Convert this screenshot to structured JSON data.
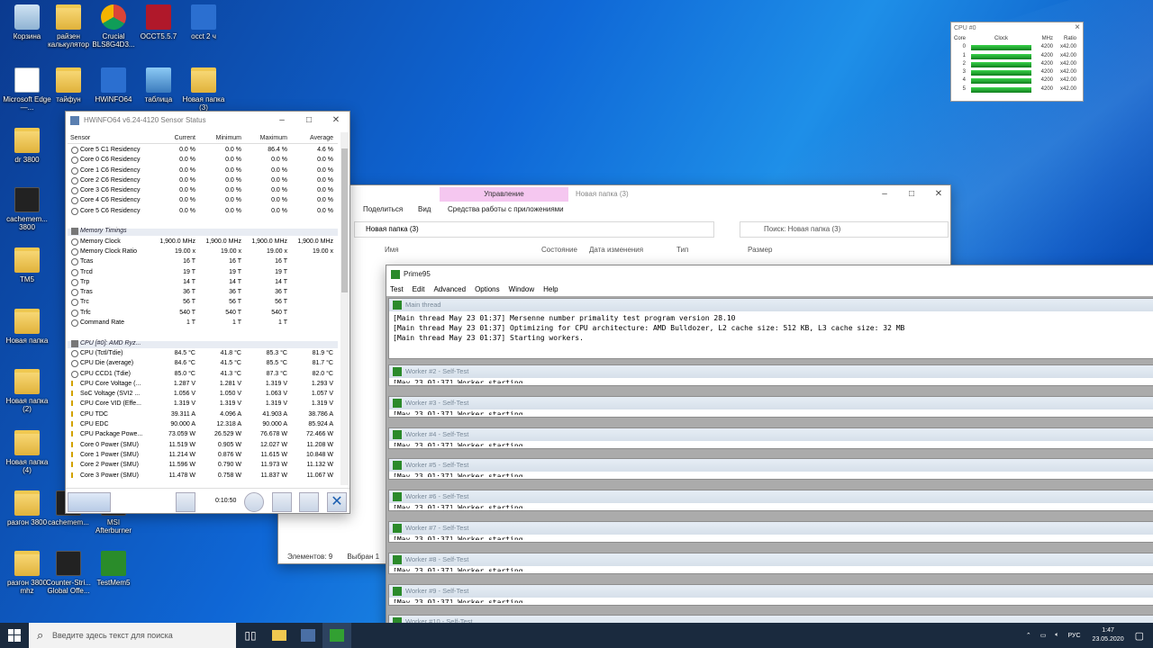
{
  "desktop_icons": [
    {
      "label": "Корзина",
      "icon": "recycle-bin-icon"
    },
    {
      "label": "райзен калькулятор",
      "icon": "folder-icon"
    },
    {
      "label": "Crucial BLS8G4D3...",
      "icon": "chrome-icon"
    },
    {
      "label": "OCCT5.5.7",
      "icon": "occt-icon"
    },
    {
      "label": "occt 2 ч",
      "icon": "screenshot-icon"
    },
    {
      "label": "Microsoft Edge —...",
      "icon": "document-icon"
    },
    {
      "label": "тайфун",
      "icon": "folder-icon"
    },
    {
      "label": "HWiNFO64",
      "icon": "hwinfo-icon"
    },
    {
      "label": "таблица",
      "icon": "image-icon"
    },
    {
      "label": "Новая папка (3)",
      "icon": "folder-icon"
    },
    {
      "label": "dr 3800",
      "icon": "folder-icon"
    },
    {
      "label": "cachemem... 3800",
      "icon": "cachemem-icon"
    },
    {
      "label": "TM5",
      "icon": "folder-icon"
    },
    {
      "label": "Новая папка",
      "icon": "folder-icon"
    },
    {
      "label": "Новая папка (2)",
      "icon": "folder-icon"
    },
    {
      "label": "Новая папка (4)",
      "icon": "folder-icon"
    },
    {
      "label": "разгон 3800",
      "icon": "folder-icon"
    },
    {
      "label": "cachemem...",
      "icon": "cachemem-icon"
    },
    {
      "label": "MSI Afterburner",
      "icon": "msi-icon"
    },
    {
      "label": "разгон 3800 mhz",
      "icon": "folder-icon"
    },
    {
      "label": "Counter-Stri... Global Offe...",
      "icon": "csgo-icon"
    },
    {
      "label": "TestMem5",
      "icon": "ram-icon"
    }
  ],
  "hwinfo": {
    "title": "HWiNFO64 v6.24-4120 Sensor Status",
    "headers": [
      "Sensor",
      "Current",
      "Minimum",
      "Maximum",
      "Average"
    ],
    "rows": [
      {
        "name": "Core 5 C1 Residency",
        "cur": "0.0 %",
        "min": "0.0 %",
        "max": "86.4 %",
        "avg": "4.6 %"
      },
      {
        "name": "Core 0 C6 Residency",
        "cur": "0.0 %",
        "min": "0.0 %",
        "max": "0.0 %",
        "avg": "0.0 %"
      },
      {
        "name": "Core 1 C6 Residency",
        "cur": "0.0 %",
        "min": "0.0 %",
        "max": "0.0 %",
        "avg": "0.0 %"
      },
      {
        "name": "Core 2 C6 Residency",
        "cur": "0.0 %",
        "min": "0.0 %",
        "max": "0.0 %",
        "avg": "0.0 %"
      },
      {
        "name": "Core 3 C6 Residency",
        "cur": "0.0 %",
        "min": "0.0 %",
        "max": "0.0 %",
        "avg": "0.0 %"
      },
      {
        "name": "Core 4 C6 Residency",
        "cur": "0.0 %",
        "min": "0.0 %",
        "max": "0.0 %",
        "avg": "0.0 %"
      },
      {
        "name": "Core 5 C6 Residency",
        "cur": "0.0 %",
        "min": "0.0 %",
        "max": "0.0 %",
        "avg": "0.0 %"
      },
      {
        "name": "",
        "cur": "",
        "min": "",
        "max": "",
        "avg": "",
        "type": "blank"
      },
      {
        "name": "Memory Timings",
        "cur": "",
        "min": "",
        "max": "",
        "avg": "",
        "type": "grp"
      },
      {
        "name": "Memory Clock",
        "cur": "1,900.0 MHz",
        "min": "1,900.0 MHz",
        "max": "1,900.0 MHz",
        "avg": "1,900.0 MHz"
      },
      {
        "name": "Memory Clock Ratio",
        "cur": "19.00 x",
        "min": "19.00 x",
        "max": "19.00 x",
        "avg": "19.00 x"
      },
      {
        "name": "Tcas",
        "cur": "16 T",
        "min": "16 T",
        "max": "16 T",
        "avg": ""
      },
      {
        "name": "Trcd",
        "cur": "19 T",
        "min": "19 T",
        "max": "19 T",
        "avg": ""
      },
      {
        "name": "Trp",
        "cur": "14 T",
        "min": "14 T",
        "max": "14 T",
        "avg": ""
      },
      {
        "name": "Tras",
        "cur": "36 T",
        "min": "36 T",
        "max": "36 T",
        "avg": ""
      },
      {
        "name": "Trc",
        "cur": "56 T",
        "min": "56 T",
        "max": "56 T",
        "avg": ""
      },
      {
        "name": "Trfc",
        "cur": "540 T",
        "min": "540 T",
        "max": "540 T",
        "avg": ""
      },
      {
        "name": "Command Rate",
        "cur": "1 T",
        "min": "1 T",
        "max": "1 T",
        "avg": ""
      },
      {
        "name": "",
        "cur": "",
        "min": "",
        "max": "",
        "avg": "",
        "type": "blank"
      },
      {
        "name": "CPU [#0]: AMD Ryz...",
        "cur": "",
        "min": "",
        "max": "",
        "avg": "",
        "type": "grp"
      },
      {
        "name": "CPU (Tctl/Tdie)",
        "cur": "84.5 °C",
        "min": "41.8 °C",
        "max": "85.3 °C",
        "avg": "81.9 °C"
      },
      {
        "name": "CPU Die (average)",
        "cur": "84.6 °C",
        "min": "41.5 °C",
        "max": "85.5 °C",
        "avg": "81.7 °C"
      },
      {
        "name": "CPU CCD1 (Tdie)",
        "cur": "85.0 °C",
        "min": "41.3 °C",
        "max": "87.3 °C",
        "avg": "82.0 °C"
      },
      {
        "name": "CPU Core Voltage (...",
        "cur": "1.287 V",
        "min": "1.281 V",
        "max": "1.319 V",
        "avg": "1.293 V",
        "type": "volt"
      },
      {
        "name": "SoC Voltage (SVI2 ...",
        "cur": "1.056 V",
        "min": "1.050 V",
        "max": "1.063 V",
        "avg": "1.057 V",
        "type": "volt"
      },
      {
        "name": "CPU Core VID (Effe...",
        "cur": "1.319 V",
        "min": "1.319 V",
        "max": "1.319 V",
        "avg": "1.319 V",
        "type": "volt"
      },
      {
        "name": "CPU TDC",
        "cur": "39.311 A",
        "min": "4.096 A",
        "max": "41.903 A",
        "avg": "38.786 A",
        "type": "volt"
      },
      {
        "name": "CPU EDC",
        "cur": "90.000 A",
        "min": "12.318 A",
        "max": "90.000 A",
        "avg": "85.924 A",
        "type": "volt"
      },
      {
        "name": "CPU Package Powe...",
        "cur": "73.059 W",
        "min": "26.529 W",
        "max": "76.678 W",
        "avg": "72.466 W",
        "type": "volt"
      },
      {
        "name": "Core 0 Power (SMU)",
        "cur": "11.519 W",
        "min": "0.905 W",
        "max": "12.027 W",
        "avg": "11.208 W",
        "type": "volt"
      },
      {
        "name": "Core 1 Power (SMU)",
        "cur": "11.214 W",
        "min": "0.876 W",
        "max": "11.615 W",
        "avg": "10.848 W",
        "type": "volt"
      },
      {
        "name": "Core 2 Power (SMU)",
        "cur": "11.596 W",
        "min": "0.790 W",
        "max": "11.973 W",
        "avg": "11.132 W",
        "type": "volt"
      },
      {
        "name": "Core 3 Power (SMU)",
        "cur": "11.478 W",
        "min": "0.758 W",
        "max": "11.837 W",
        "avg": "11.067 W",
        "type": "volt"
      }
    ],
    "timer": "0:10:50"
  },
  "cpu_widget": {
    "title": "CPU #0",
    "headers": [
      "Core",
      "Clock",
      "MHz",
      "Ratio"
    ],
    "rows": [
      {
        "core": "0",
        "mhz": "4200",
        "ratio": "x42.00"
      },
      {
        "core": "1",
        "mhz": "4200",
        "ratio": "x42.00"
      },
      {
        "core": "2",
        "mhz": "4200",
        "ratio": "x42.00"
      },
      {
        "core": "3",
        "mhz": "4200",
        "ratio": "x42.00"
      },
      {
        "core": "4",
        "mhz": "4200",
        "ratio": "x42.00"
      },
      {
        "core": "5",
        "mhz": "4200",
        "ratio": "x42.00"
      }
    ]
  },
  "explorer": {
    "manage_tab": "Управление",
    "title": "Новая папка (3)",
    "tabs": [
      "Поделиться",
      "Вид",
      "Средства работы с приложениями"
    ],
    "address": "Новая папка (3)",
    "search_placeholder": "Поиск: Новая папка (3)",
    "columns": [
      "Имя",
      "Состояние",
      "Дата изменения",
      "Тип",
      "Размер"
    ],
    "status_count": "Элементов: 9",
    "status_selected": "Выбран 1"
  },
  "prime95": {
    "title": "Prime95",
    "menu": [
      "Test",
      "Edit",
      "Advanced",
      "Options",
      "Window",
      "Help"
    ],
    "main_title": "Main thread",
    "main_lines": [
      "[Main thread May 23 01:37] Mersenne number primality test program version 28.10",
      "[Main thread May 23 01:37] Optimizing for CPU architecture: AMD Bulldozer, L2 cache size: 512 KB, L3 cache size: 32 MB",
      "[Main thread May 23 01:37] Starting workers."
    ],
    "workers": [
      "Worker #2 - Self-Test",
      "Worker #3 - Self-Test",
      "Worker #4 - Self-Test",
      "Worker #5 - Self-Test",
      "Worker #6 - Self-Test",
      "Worker #7 - Self-Test",
      "Worker #8 - Self-Test",
      "Worker #9 - Self-Test",
      "Worker #10 - Self-Test"
    ],
    "worker_line": "[May 23 01:37] Worker starting"
  },
  "taskbar": {
    "search_placeholder": "Введите здесь текст для поиска",
    "language": "РУС",
    "time": "1:47",
    "date": "23.05.2020"
  }
}
